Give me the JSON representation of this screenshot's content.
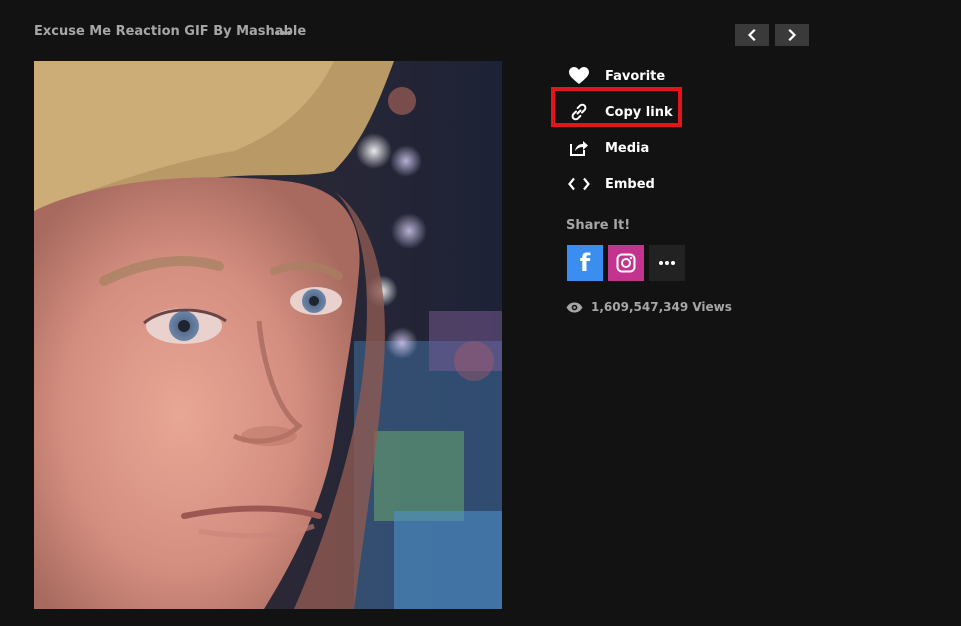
{
  "header": {
    "title": "Excuse Me Reaction GIF By Mashable",
    "more_icon": "ellipsis-icon",
    "prev_icon": "chevron-left-icon",
    "next_icon": "chevron-right-icon"
  },
  "gif": {
    "subject": "close-up of blond man looking sideways"
  },
  "actions": [
    {
      "label": "Favorite",
      "icon": "heart-icon"
    },
    {
      "label": "Copy link",
      "icon": "link-icon"
    },
    {
      "label": "Media",
      "icon": "share-out-icon"
    },
    {
      "label": "Embed",
      "icon": "code-brackets-icon"
    }
  ],
  "highlight": {
    "color": "#e4141d",
    "target": "Copy link"
  },
  "share": {
    "title": "Share It!",
    "buttons": [
      {
        "name": "facebook",
        "icon": "facebook-icon",
        "color": "#3b8df0"
      },
      {
        "name": "instagram",
        "icon": "instagram-icon",
        "color": "#c2348e"
      },
      {
        "name": "more",
        "icon": "ellipsis-icon",
        "color": "#222222"
      }
    ]
  },
  "views": {
    "count": "1,609,547,349",
    "label": "Views",
    "text": "1,609,547,349 Views",
    "icon": "eye-icon"
  },
  "colors": {
    "background": "#121212",
    "muted_text": "#a6a6a6",
    "button_bg": "#3a3a3a"
  }
}
